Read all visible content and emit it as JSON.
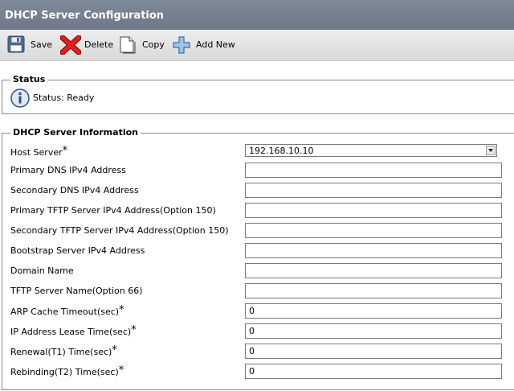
{
  "window": {
    "title": "DHCP Server Configuration"
  },
  "toolbar": {
    "save_label": "Save",
    "delete_label": "Delete",
    "copy_label": "Copy",
    "add_new_label": "Add New",
    "icons": {
      "save": "floppy-disk-icon",
      "delete": "red-x-icon",
      "copy": "document-copy-icon",
      "add_new": "blue-plus-icon"
    }
  },
  "status": {
    "legend": "Status",
    "text": "Status: Ready",
    "icon": "info-icon"
  },
  "info": {
    "legend": "DHCP Server Information",
    "required_mark": "*",
    "host_server": {
      "label": "Host Server",
      "value": "192.168.10.10"
    },
    "primary_dns": {
      "label": "Primary DNS IPv4 Address",
      "value": ""
    },
    "secondary_dns": {
      "label": "Secondary DNS IPv4 Address",
      "value": ""
    },
    "primary_tftp": {
      "label": "Primary TFTP Server IPv4 Address(Option 150)",
      "value": ""
    },
    "secondary_tftp": {
      "label": "Secondary TFTP Server IPv4 Address(Option 150)",
      "value": ""
    },
    "bootstrap": {
      "label": "Bootstrap Server IPv4 Address",
      "value": ""
    },
    "domain_name": {
      "label": "Domain Name",
      "value": ""
    },
    "tftp_name": {
      "label": "TFTP Server Name(Option 66)",
      "value": ""
    },
    "arp_timeout": {
      "label": "ARP Cache Timeout(sec)",
      "value": "0"
    },
    "lease_time": {
      "label": "IP Address Lease Time(sec)",
      "value": "0"
    },
    "renewal": {
      "label": "Renewal(T1) Time(sec)",
      "value": "0"
    },
    "rebinding": {
      "label": "Rebinding(T2) Time(sec)",
      "value": "0"
    }
  }
}
